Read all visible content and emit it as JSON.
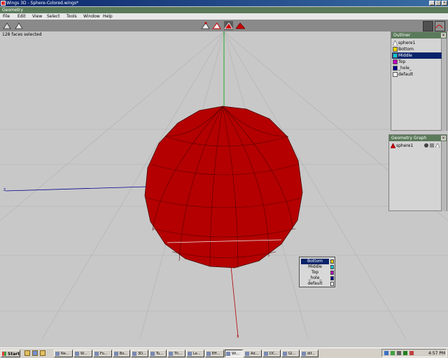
{
  "window": {
    "title": "Wings 3D - Sphere-Colored.wings*"
  },
  "geometry_strip": {
    "label": "Geometry"
  },
  "menu": {
    "items": [
      "File",
      "Edit",
      "View",
      "Select",
      "Tools",
      "Window",
      "Help"
    ]
  },
  "status": {
    "text": "128 faces selected"
  },
  "outliner": {
    "title": "Outliner",
    "items": [
      {
        "label": "sphere1",
        "icon": "triangle-icon"
      },
      {
        "label": "Bottom",
        "icon": "material-icon",
        "color": "#e8d000"
      },
      {
        "label": "Middle",
        "icon": "material-icon",
        "color": "#00c8d8",
        "selected": true
      },
      {
        "label": "Top",
        "icon": "material-icon",
        "color": "#c000c0"
      },
      {
        "label": "_hole_",
        "icon": "material-icon",
        "color": "#00008a"
      },
      {
        "label": "default",
        "icon": "material-icon",
        "color": "#ffffff"
      }
    ]
  },
  "geometry_graph": {
    "title": "Geometry Graph",
    "items": [
      {
        "label": "sphere1"
      }
    ]
  },
  "popup": {
    "items": [
      {
        "label": "Bottom",
        "color": "#e8d000",
        "highlighted": true
      },
      {
        "label": "Middle",
        "color": "#00c8d8"
      },
      {
        "label": "Top",
        "color": "#c000c0"
      },
      {
        "label": "_hole_",
        "color": "#00008a"
      },
      {
        "label": "default",
        "color": "#ffffff"
      }
    ]
  },
  "viewport": {
    "axis_labels": {
      "x": "x",
      "z": "z"
    },
    "colors": {
      "sphere": "#b40000",
      "x_axis": "#b00000",
      "y_axis": "#00a000",
      "z_axis": "#000090",
      "background": "#c8c8c8"
    }
  },
  "taskbar": {
    "start_label": "Start",
    "tasks": [
      "Ne...",
      "W...",
      "Fo...",
      "Bo...",
      "3D...",
      "Tu...",
      "Th...",
      "Le...",
      "Eff...",
      "Wi...",
      "Ad...",
      "DC...",
      "Gl...",
      "dif..."
    ],
    "clock": "4:57 PM"
  }
}
